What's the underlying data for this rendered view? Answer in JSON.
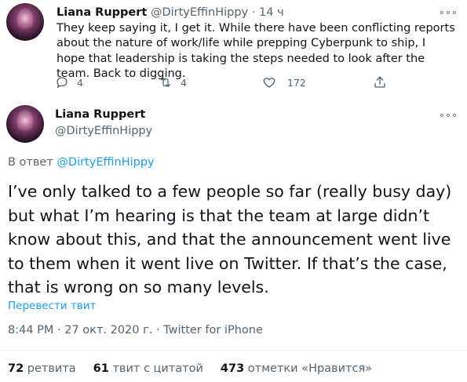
{
  "tweet1": {
    "name": "Liana Ruppert",
    "handle": "@DirtyEffinHippy",
    "separator": "·",
    "time": "14 ч",
    "text": "They keep saying it, I get it. While there have been conflicting reports about the nature of work/life while prepping Cyberpunk to ship, I hope that leadership is taking the steps needed to look after the team. Back to digging.",
    "reply_count": "4",
    "retweet_count": "4",
    "like_count": "172"
  },
  "tweet2": {
    "name": "Liana Ruppert",
    "handle": "@DirtyEffinHippy",
    "reply_prefix": "В ответ",
    "reply_handle": "@DirtyEffinHippy",
    "text": "I’ve only talked to a few people so far (really busy day) but what I’m hearing is that the team at large didn’t know about this, and that the announcement went live to them when it went live on Twitter. If that’s the case, that is wrong on so many levels.",
    "translate": "Перевести твит",
    "meta": "8:44 PM · 27 окт. 2020 г. · Twitter for iPhone"
  },
  "stats": {
    "retweets_count": "72",
    "retweets_label": "ретвита",
    "quotes_count": "61",
    "quotes_label": "твит с цитатой",
    "likes_count": "473",
    "likes_label": "отметки «Нравится»"
  },
  "icons": {
    "reply": "reply-icon",
    "retweet": "retweet-icon",
    "like": "heart-icon",
    "share": "share-icon",
    "more": "more-icon"
  },
  "colors": {
    "link": "#1d9bf0",
    "muted": "#536471",
    "text": "#0f1419"
  }
}
